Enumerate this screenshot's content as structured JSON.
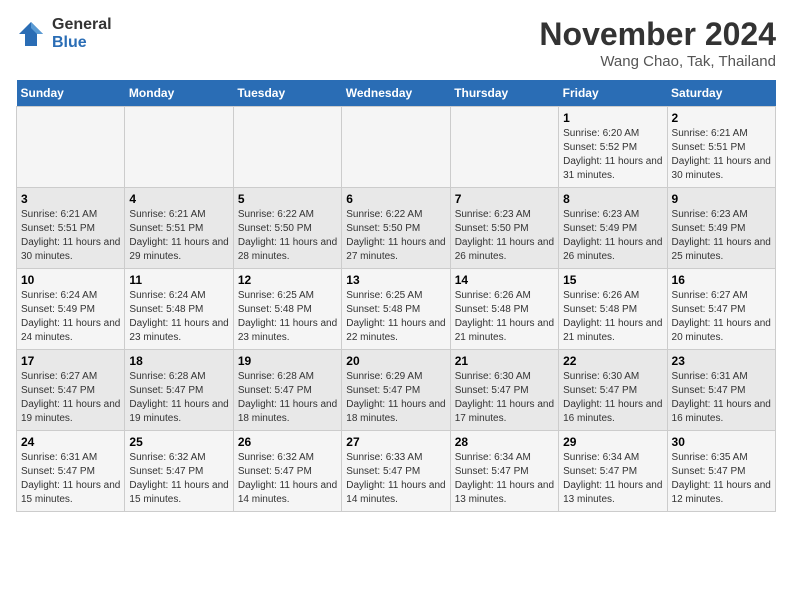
{
  "logo": {
    "general": "General",
    "blue": "Blue"
  },
  "title": "November 2024",
  "location": "Wang Chao, Tak, Thailand",
  "days_of_week": [
    "Sunday",
    "Monday",
    "Tuesday",
    "Wednesday",
    "Thursday",
    "Friday",
    "Saturday"
  ],
  "weeks": [
    [
      {
        "day": "",
        "info": ""
      },
      {
        "day": "",
        "info": ""
      },
      {
        "day": "",
        "info": ""
      },
      {
        "day": "",
        "info": ""
      },
      {
        "day": "",
        "info": ""
      },
      {
        "day": "1",
        "info": "Sunrise: 6:20 AM\nSunset: 5:52 PM\nDaylight: 11 hours and 31 minutes."
      },
      {
        "day": "2",
        "info": "Sunrise: 6:21 AM\nSunset: 5:51 PM\nDaylight: 11 hours and 30 minutes."
      }
    ],
    [
      {
        "day": "3",
        "info": "Sunrise: 6:21 AM\nSunset: 5:51 PM\nDaylight: 11 hours and 30 minutes."
      },
      {
        "day": "4",
        "info": "Sunrise: 6:21 AM\nSunset: 5:51 PM\nDaylight: 11 hours and 29 minutes."
      },
      {
        "day": "5",
        "info": "Sunrise: 6:22 AM\nSunset: 5:50 PM\nDaylight: 11 hours and 28 minutes."
      },
      {
        "day": "6",
        "info": "Sunrise: 6:22 AM\nSunset: 5:50 PM\nDaylight: 11 hours and 27 minutes."
      },
      {
        "day": "7",
        "info": "Sunrise: 6:23 AM\nSunset: 5:50 PM\nDaylight: 11 hours and 26 minutes."
      },
      {
        "day": "8",
        "info": "Sunrise: 6:23 AM\nSunset: 5:49 PM\nDaylight: 11 hours and 26 minutes."
      },
      {
        "day": "9",
        "info": "Sunrise: 6:23 AM\nSunset: 5:49 PM\nDaylight: 11 hours and 25 minutes."
      }
    ],
    [
      {
        "day": "10",
        "info": "Sunrise: 6:24 AM\nSunset: 5:49 PM\nDaylight: 11 hours and 24 minutes."
      },
      {
        "day": "11",
        "info": "Sunrise: 6:24 AM\nSunset: 5:48 PM\nDaylight: 11 hours and 23 minutes."
      },
      {
        "day": "12",
        "info": "Sunrise: 6:25 AM\nSunset: 5:48 PM\nDaylight: 11 hours and 23 minutes."
      },
      {
        "day": "13",
        "info": "Sunrise: 6:25 AM\nSunset: 5:48 PM\nDaylight: 11 hours and 22 minutes."
      },
      {
        "day": "14",
        "info": "Sunrise: 6:26 AM\nSunset: 5:48 PM\nDaylight: 11 hours and 21 minutes."
      },
      {
        "day": "15",
        "info": "Sunrise: 6:26 AM\nSunset: 5:48 PM\nDaylight: 11 hours and 21 minutes."
      },
      {
        "day": "16",
        "info": "Sunrise: 6:27 AM\nSunset: 5:47 PM\nDaylight: 11 hours and 20 minutes."
      }
    ],
    [
      {
        "day": "17",
        "info": "Sunrise: 6:27 AM\nSunset: 5:47 PM\nDaylight: 11 hours and 19 minutes."
      },
      {
        "day": "18",
        "info": "Sunrise: 6:28 AM\nSunset: 5:47 PM\nDaylight: 11 hours and 19 minutes."
      },
      {
        "day": "19",
        "info": "Sunrise: 6:28 AM\nSunset: 5:47 PM\nDaylight: 11 hours and 18 minutes."
      },
      {
        "day": "20",
        "info": "Sunrise: 6:29 AM\nSunset: 5:47 PM\nDaylight: 11 hours and 18 minutes."
      },
      {
        "day": "21",
        "info": "Sunrise: 6:30 AM\nSunset: 5:47 PM\nDaylight: 11 hours and 17 minutes."
      },
      {
        "day": "22",
        "info": "Sunrise: 6:30 AM\nSunset: 5:47 PM\nDaylight: 11 hours and 16 minutes."
      },
      {
        "day": "23",
        "info": "Sunrise: 6:31 AM\nSunset: 5:47 PM\nDaylight: 11 hours and 16 minutes."
      }
    ],
    [
      {
        "day": "24",
        "info": "Sunrise: 6:31 AM\nSunset: 5:47 PM\nDaylight: 11 hours and 15 minutes."
      },
      {
        "day": "25",
        "info": "Sunrise: 6:32 AM\nSunset: 5:47 PM\nDaylight: 11 hours and 15 minutes."
      },
      {
        "day": "26",
        "info": "Sunrise: 6:32 AM\nSunset: 5:47 PM\nDaylight: 11 hours and 14 minutes."
      },
      {
        "day": "27",
        "info": "Sunrise: 6:33 AM\nSunset: 5:47 PM\nDaylight: 11 hours and 14 minutes."
      },
      {
        "day": "28",
        "info": "Sunrise: 6:34 AM\nSunset: 5:47 PM\nDaylight: 11 hours and 13 minutes."
      },
      {
        "day": "29",
        "info": "Sunrise: 6:34 AM\nSunset: 5:47 PM\nDaylight: 11 hours and 13 minutes."
      },
      {
        "day": "30",
        "info": "Sunrise: 6:35 AM\nSunset: 5:47 PM\nDaylight: 11 hours and 12 minutes."
      }
    ]
  ]
}
